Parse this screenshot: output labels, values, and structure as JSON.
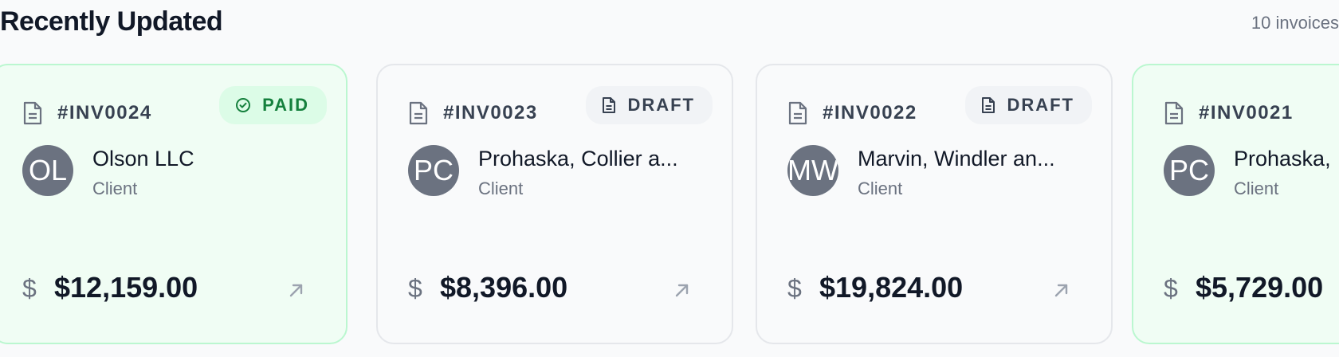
{
  "section": {
    "title": "Recently Updated",
    "count_label": "10 invoices"
  },
  "icons": {
    "invoice": "document-icon",
    "paid_status": "check-circle-icon",
    "draft_status": "document-icon",
    "amount": "dollar-icon",
    "open": "arrow-up-right-icon"
  },
  "colors": {
    "paid_accent": "#15803d",
    "paid_background": "#f0fdf4",
    "avatar_background": "#6b7280"
  },
  "invoices": [
    {
      "number": "#INV0024",
      "status": "PAID",
      "status_type": "paid",
      "initials": "OL",
      "client": "Olson LLC",
      "role": "Client",
      "currency_symbol": "$",
      "amount": "$12,159.00"
    },
    {
      "number": "#INV0023",
      "status": "DRAFT",
      "status_type": "draft",
      "initials": "PC",
      "client": "Prohaska, Collier a...",
      "role": "Client",
      "currency_symbol": "$",
      "amount": "$8,396.00"
    },
    {
      "number": "#INV0022",
      "status": "DRAFT",
      "status_type": "draft",
      "initials": "MW",
      "client": "Marvin, Windler an...",
      "role": "Client",
      "currency_symbol": "$",
      "amount": "$19,824.00"
    },
    {
      "number": "#INV0021",
      "status": "PAID",
      "status_type": "paid",
      "initials": "PC",
      "client": "Prohaska,",
      "role": "Client",
      "currency_symbol": "$",
      "amount": "$5,729.00"
    }
  ]
}
